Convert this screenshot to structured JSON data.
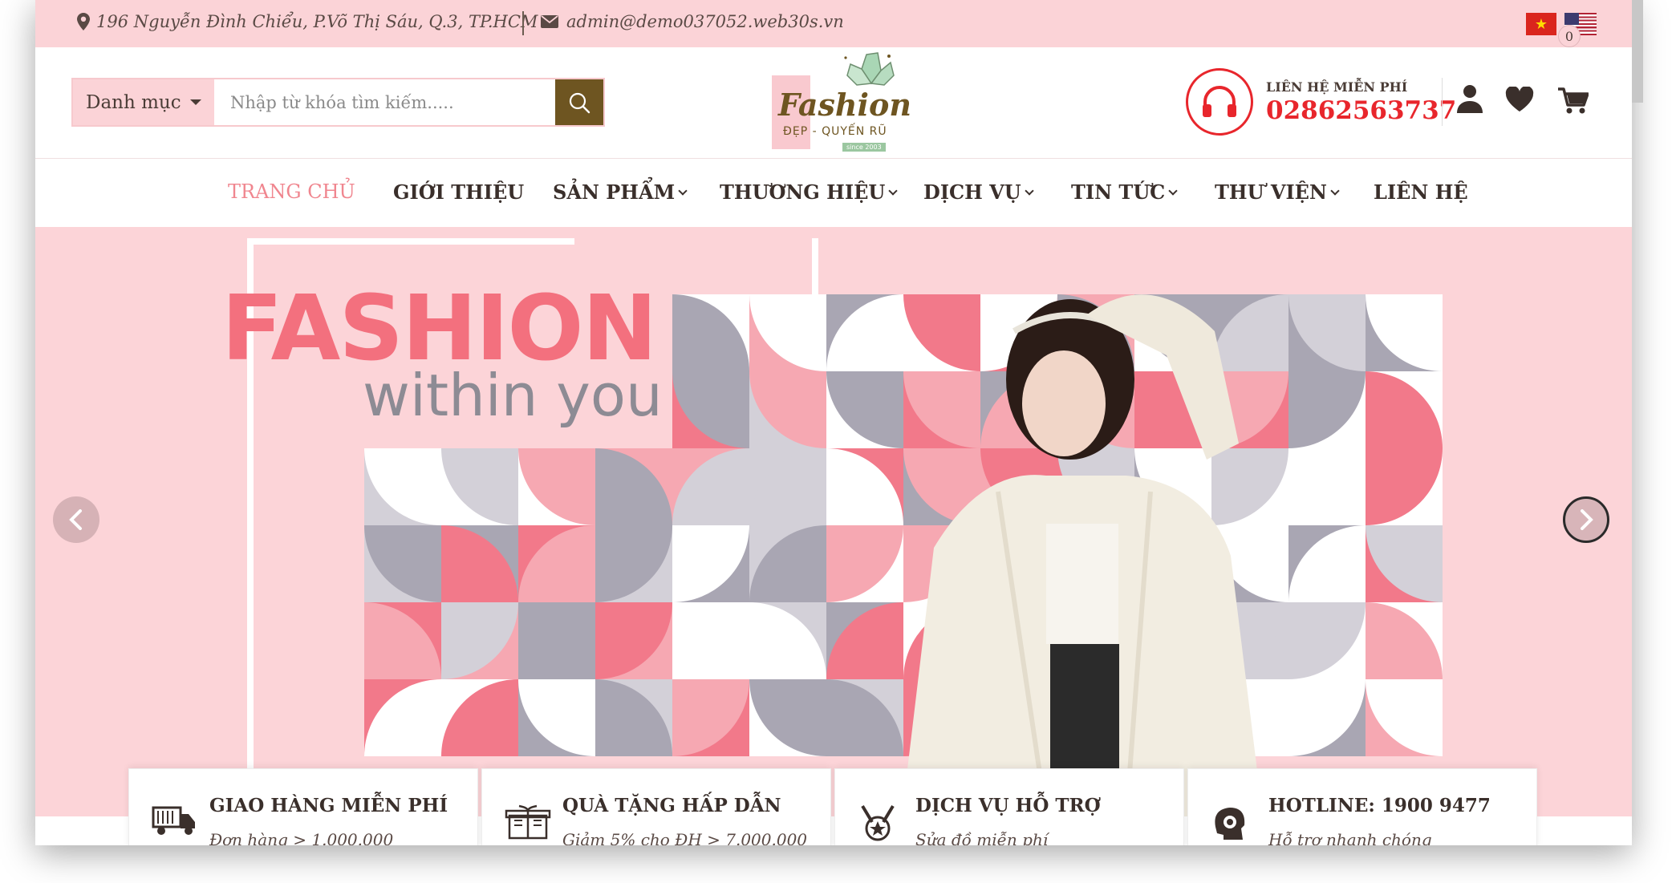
{
  "topbar": {
    "address": "196 Nguyễn Đình Chiểu, P.Võ Thị Sáu, Q.3, TP.HCM",
    "email": "admin@demo037052.web30s.vn"
  },
  "search": {
    "category_label": "Danh mục",
    "placeholder": "Nhập từ khóa tìm kiếm....."
  },
  "logo": {
    "word": "Fashion",
    "tagline": "ĐẸP - QUYẾN RŨ",
    "since": "since 2003"
  },
  "hotline": {
    "label": "LIÊN HỆ MIỄN PHÍ",
    "number": "02862563737"
  },
  "cart": {
    "count": "0"
  },
  "nav": {
    "items": [
      {
        "label": "TRANG CHỦ"
      },
      {
        "label": "GIỚI THIỆU"
      },
      {
        "label": "SẢN PHẨM"
      },
      {
        "label": "THƯƠNG HIỆU"
      },
      {
        "label": "DỊCH VỤ"
      },
      {
        "label": "TIN TỨC"
      },
      {
        "label": "THƯ VIỆN"
      },
      {
        "label": "LIÊN HỆ"
      }
    ]
  },
  "banner": {
    "headline": "FASHION",
    "subline": "within you"
  },
  "features": [
    {
      "title": "GIAO HÀNG MIỄN PHÍ",
      "subtitle": "Đơn hàng > 1.000.000",
      "icon": "truck-icon"
    },
    {
      "title": "QUÀ TẶNG HẤP DẪN",
      "subtitle": "Giảm 5% cho ĐH > 7.000.000",
      "icon": "gift-icon"
    },
    {
      "title": "DỊCH VỤ HỖ TRỢ",
      "subtitle": "Sửa đồ miễn phí",
      "icon": "medal-icon"
    },
    {
      "title": "HOTLINE: 1900 9477",
      "subtitle": "Hỗ trợ nhanh chóng",
      "icon": "support-head-icon"
    }
  ],
  "colors": {
    "pink_bg": "#fbd3d7",
    "accent_brown": "#6e5521",
    "hotline_red": "#e8262c",
    "active_nav": "#f0868f",
    "banner_pink": "#f3707e"
  }
}
